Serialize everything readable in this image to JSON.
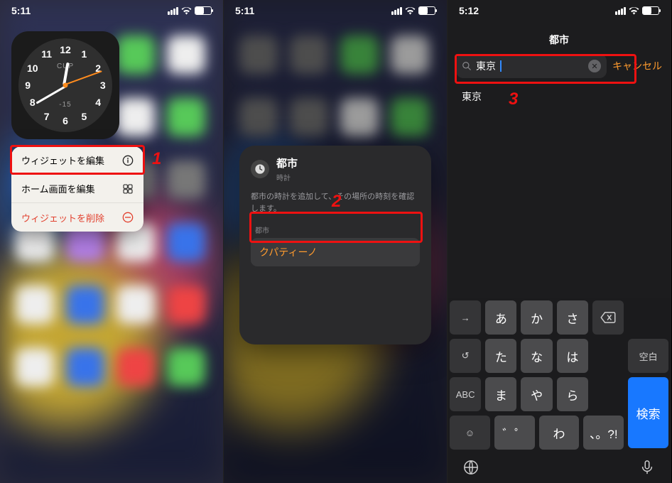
{
  "screen1": {
    "time": "5:11",
    "clock": {
      "city_code": "CUP",
      "temp": "-15",
      "numbers": [
        "12",
        "1",
        "2",
        "3",
        "4",
        "5",
        "6",
        "7",
        "8",
        "9",
        "10",
        "11"
      ]
    },
    "menu": {
      "edit_widget": "ウィジェットを編集",
      "edit_home": "ホーム画面を編集",
      "remove_widget": "ウィジェットを削除"
    },
    "anno": "1"
  },
  "screen2": {
    "time": "5:11",
    "sheet": {
      "title": "都市",
      "subtitle": "時計",
      "description": "都市の時計を追加して、その場所の時刻を確認します。",
      "field_label": "都市",
      "field_value": "クパティーノ"
    },
    "anno": "2"
  },
  "screen3": {
    "time": "5:12",
    "title": "都市",
    "search_value": "東京",
    "cancel": "キャンセル",
    "result": "東京",
    "anno": "3",
    "keys": {
      "arrow": "→",
      "a": "あ",
      "ka": "か",
      "sa": "さ",
      "undo": "↺",
      "ta": "た",
      "na": "な",
      "ha": "は",
      "abc": "ABC",
      "ma": "ま",
      "ya": "や",
      "ra": "ら",
      "emoji": "☺",
      "dakuten": "゛゜",
      "wa": "わ",
      "punct": "、。?!",
      "space": "空白",
      "search": "検索"
    }
  }
}
